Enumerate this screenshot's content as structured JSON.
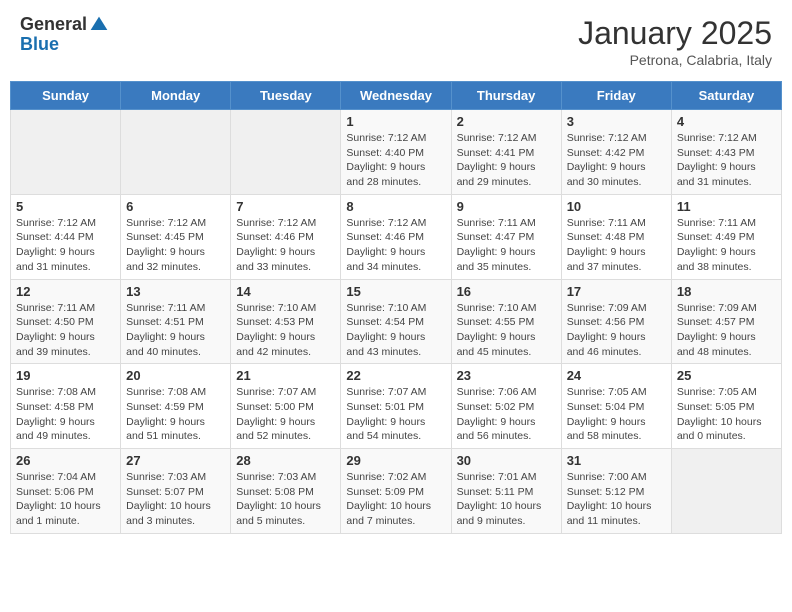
{
  "header": {
    "logo_general": "General",
    "logo_blue": "Blue",
    "month_title": "January 2025",
    "location": "Petrona, Calabria, Italy"
  },
  "weekdays": [
    "Sunday",
    "Monday",
    "Tuesday",
    "Wednesday",
    "Thursday",
    "Friday",
    "Saturday"
  ],
  "weeks": [
    [
      {
        "day": "",
        "info": ""
      },
      {
        "day": "",
        "info": ""
      },
      {
        "day": "",
        "info": ""
      },
      {
        "day": "1",
        "info": "Sunrise: 7:12 AM\nSunset: 4:40 PM\nDaylight: 9 hours\nand 28 minutes."
      },
      {
        "day": "2",
        "info": "Sunrise: 7:12 AM\nSunset: 4:41 PM\nDaylight: 9 hours\nand 29 minutes."
      },
      {
        "day": "3",
        "info": "Sunrise: 7:12 AM\nSunset: 4:42 PM\nDaylight: 9 hours\nand 30 minutes."
      },
      {
        "day": "4",
        "info": "Sunrise: 7:12 AM\nSunset: 4:43 PM\nDaylight: 9 hours\nand 31 minutes."
      }
    ],
    [
      {
        "day": "5",
        "info": "Sunrise: 7:12 AM\nSunset: 4:44 PM\nDaylight: 9 hours\nand 31 minutes."
      },
      {
        "day": "6",
        "info": "Sunrise: 7:12 AM\nSunset: 4:45 PM\nDaylight: 9 hours\nand 32 minutes."
      },
      {
        "day": "7",
        "info": "Sunrise: 7:12 AM\nSunset: 4:46 PM\nDaylight: 9 hours\nand 33 minutes."
      },
      {
        "day": "8",
        "info": "Sunrise: 7:12 AM\nSunset: 4:46 PM\nDaylight: 9 hours\nand 34 minutes."
      },
      {
        "day": "9",
        "info": "Sunrise: 7:11 AM\nSunset: 4:47 PM\nDaylight: 9 hours\nand 35 minutes."
      },
      {
        "day": "10",
        "info": "Sunrise: 7:11 AM\nSunset: 4:48 PM\nDaylight: 9 hours\nand 37 minutes."
      },
      {
        "day": "11",
        "info": "Sunrise: 7:11 AM\nSunset: 4:49 PM\nDaylight: 9 hours\nand 38 minutes."
      }
    ],
    [
      {
        "day": "12",
        "info": "Sunrise: 7:11 AM\nSunset: 4:50 PM\nDaylight: 9 hours\nand 39 minutes."
      },
      {
        "day": "13",
        "info": "Sunrise: 7:11 AM\nSunset: 4:51 PM\nDaylight: 9 hours\nand 40 minutes."
      },
      {
        "day": "14",
        "info": "Sunrise: 7:10 AM\nSunset: 4:53 PM\nDaylight: 9 hours\nand 42 minutes."
      },
      {
        "day": "15",
        "info": "Sunrise: 7:10 AM\nSunset: 4:54 PM\nDaylight: 9 hours\nand 43 minutes."
      },
      {
        "day": "16",
        "info": "Sunrise: 7:10 AM\nSunset: 4:55 PM\nDaylight: 9 hours\nand 45 minutes."
      },
      {
        "day": "17",
        "info": "Sunrise: 7:09 AM\nSunset: 4:56 PM\nDaylight: 9 hours\nand 46 minutes."
      },
      {
        "day": "18",
        "info": "Sunrise: 7:09 AM\nSunset: 4:57 PM\nDaylight: 9 hours\nand 48 minutes."
      }
    ],
    [
      {
        "day": "19",
        "info": "Sunrise: 7:08 AM\nSunset: 4:58 PM\nDaylight: 9 hours\nand 49 minutes."
      },
      {
        "day": "20",
        "info": "Sunrise: 7:08 AM\nSunset: 4:59 PM\nDaylight: 9 hours\nand 51 minutes."
      },
      {
        "day": "21",
        "info": "Sunrise: 7:07 AM\nSunset: 5:00 PM\nDaylight: 9 hours\nand 52 minutes."
      },
      {
        "day": "22",
        "info": "Sunrise: 7:07 AM\nSunset: 5:01 PM\nDaylight: 9 hours\nand 54 minutes."
      },
      {
        "day": "23",
        "info": "Sunrise: 7:06 AM\nSunset: 5:02 PM\nDaylight: 9 hours\nand 56 minutes."
      },
      {
        "day": "24",
        "info": "Sunrise: 7:05 AM\nSunset: 5:04 PM\nDaylight: 9 hours\nand 58 minutes."
      },
      {
        "day": "25",
        "info": "Sunrise: 7:05 AM\nSunset: 5:05 PM\nDaylight: 10 hours\nand 0 minutes."
      }
    ],
    [
      {
        "day": "26",
        "info": "Sunrise: 7:04 AM\nSunset: 5:06 PM\nDaylight: 10 hours\nand 1 minute."
      },
      {
        "day": "27",
        "info": "Sunrise: 7:03 AM\nSunset: 5:07 PM\nDaylight: 10 hours\nand 3 minutes."
      },
      {
        "day": "28",
        "info": "Sunrise: 7:03 AM\nSunset: 5:08 PM\nDaylight: 10 hours\nand 5 minutes."
      },
      {
        "day": "29",
        "info": "Sunrise: 7:02 AM\nSunset: 5:09 PM\nDaylight: 10 hours\nand 7 minutes."
      },
      {
        "day": "30",
        "info": "Sunrise: 7:01 AM\nSunset: 5:11 PM\nDaylight: 10 hours\nand 9 minutes."
      },
      {
        "day": "31",
        "info": "Sunrise: 7:00 AM\nSunset: 5:12 PM\nDaylight: 10 hours\nand 11 minutes."
      },
      {
        "day": "",
        "info": ""
      }
    ]
  ]
}
